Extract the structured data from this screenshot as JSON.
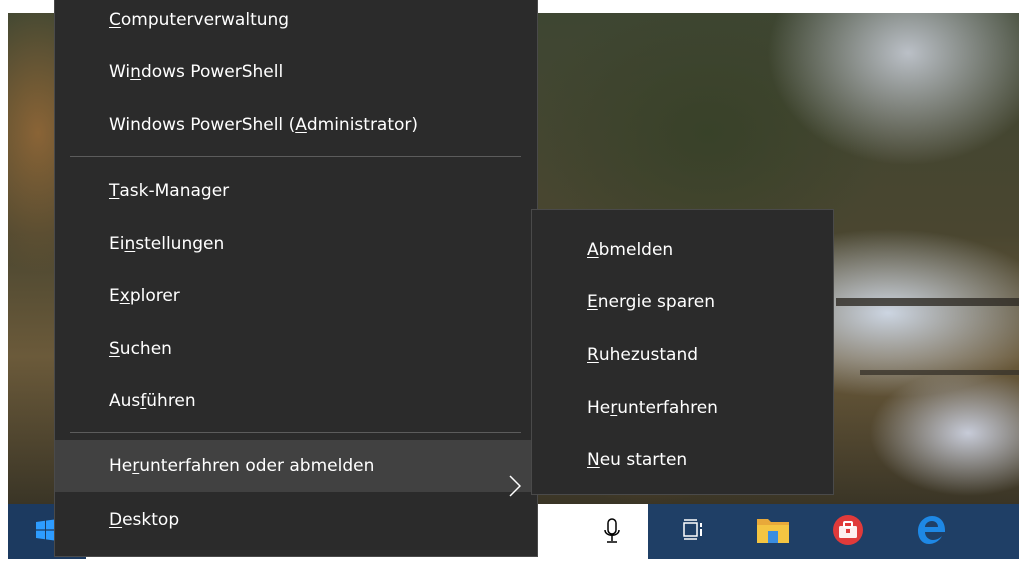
{
  "winx_menu": {
    "items": [
      {
        "id": "computerverwaltung",
        "pre": "",
        "acc": "C",
        "post": "omputerverwaltung"
      },
      {
        "id": "powershell",
        "pre": "Wi",
        "acc": "n",
        "post": "dows PowerShell"
      },
      {
        "id": "powershell-admin",
        "pre": "Windows PowerShell (",
        "acc": "A",
        "post": "dministrator)"
      },
      {
        "id": "task-manager",
        "pre": "",
        "acc": "T",
        "post": "ask-Manager"
      },
      {
        "id": "einstellungen",
        "pre": "Ei",
        "acc": "n",
        "post": "stellungen"
      },
      {
        "id": "explorer",
        "pre": "E",
        "acc": "x",
        "post": "plorer"
      },
      {
        "id": "suchen",
        "pre": "",
        "acc": "S",
        "post": "uchen"
      },
      {
        "id": "ausfuehren",
        "pre": "Aus",
        "acc": "f",
        "post": "ühren"
      },
      {
        "id": "shutdown-signout",
        "pre": "He",
        "acc": "r",
        "post": "unterfahren oder abmelden"
      },
      {
        "id": "desktop",
        "pre": "",
        "acc": "D",
        "post": "esktop"
      }
    ],
    "highlighted": "shutdown-signout",
    "chevron_icon": "chevron-right-icon"
  },
  "power_submenu": {
    "items": [
      {
        "id": "abmelden",
        "pre": "",
        "acc": "A",
        "post": "bmelden"
      },
      {
        "id": "energie-sparen",
        "pre": "",
        "acc": "E",
        "post": "nergie sparen"
      },
      {
        "id": "ruhezustand",
        "pre": "",
        "acc": "R",
        "post": "uhezustand"
      },
      {
        "id": "herunterfahren",
        "pre": "He",
        "acc": "r",
        "post": "unterfahren"
      },
      {
        "id": "neu-starten",
        "pre": "",
        "acc": "N",
        "post": "eu starten"
      }
    ]
  },
  "taskbar": {
    "icons": [
      "windows-logo-icon",
      "microphone-icon",
      "task-view-icon",
      "file-explorer-icon",
      "toolbox-icon",
      "edge-icon"
    ]
  },
  "colors": {
    "menu_bg": "#2b2b2b",
    "menu_highlight": "#414141",
    "taskbar": "#1f3f66",
    "windows_blue": "#2d9cff",
    "edge_blue": "#1e88e5",
    "toolbox_red": "#e03a3a",
    "folder_yellow": "#f4c542"
  }
}
